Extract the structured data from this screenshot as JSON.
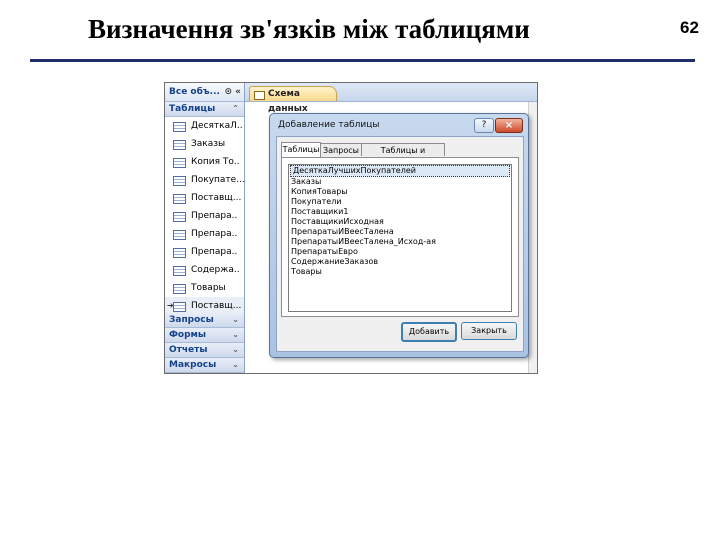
{
  "slide": {
    "title": "Визначення зв'язків між таблицями",
    "page_number": "62"
  },
  "nav_pane": {
    "header_label": "Все объ...",
    "header_icons": "⊙ «",
    "groups": {
      "tables": "Таблицы",
      "queries": "Запросы",
      "forms": "Формы",
      "reports": "Отчеты",
      "macros": "Макросы"
    },
    "items": [
      "ДесяткаЛ..",
      "Заказы",
      "Копия То..",
      "Покупате...",
      "Поставщ...",
      "Препара..",
      "Препара..",
      "Препара..",
      "Содержа..",
      "Товары",
      "Поставщ..."
    ]
  },
  "document": {
    "tab_label": "Схема данных"
  },
  "dialog": {
    "title": "Добавление таблицы",
    "help_label": "?",
    "close_label": "×",
    "tabs": [
      "Таблицы",
      "Запросы",
      "Таблицы и запросы"
    ],
    "list_items": [
      "ДесяткаЛучшихПокупателей",
      "Заказы",
      "КопияТовары",
      "Покупатели",
      "Поставщики1",
      "ПоставщикиИсходная",
      "ПрепаратыИВеесТалена",
      "ПрепаратыИВеесТалена_Исход-ая",
      "ПрепаратыЕвро",
      "СодержаниеЗаказов",
      "Товары"
    ],
    "add_button": "Добавить",
    "close_button": "Закрыть"
  }
}
